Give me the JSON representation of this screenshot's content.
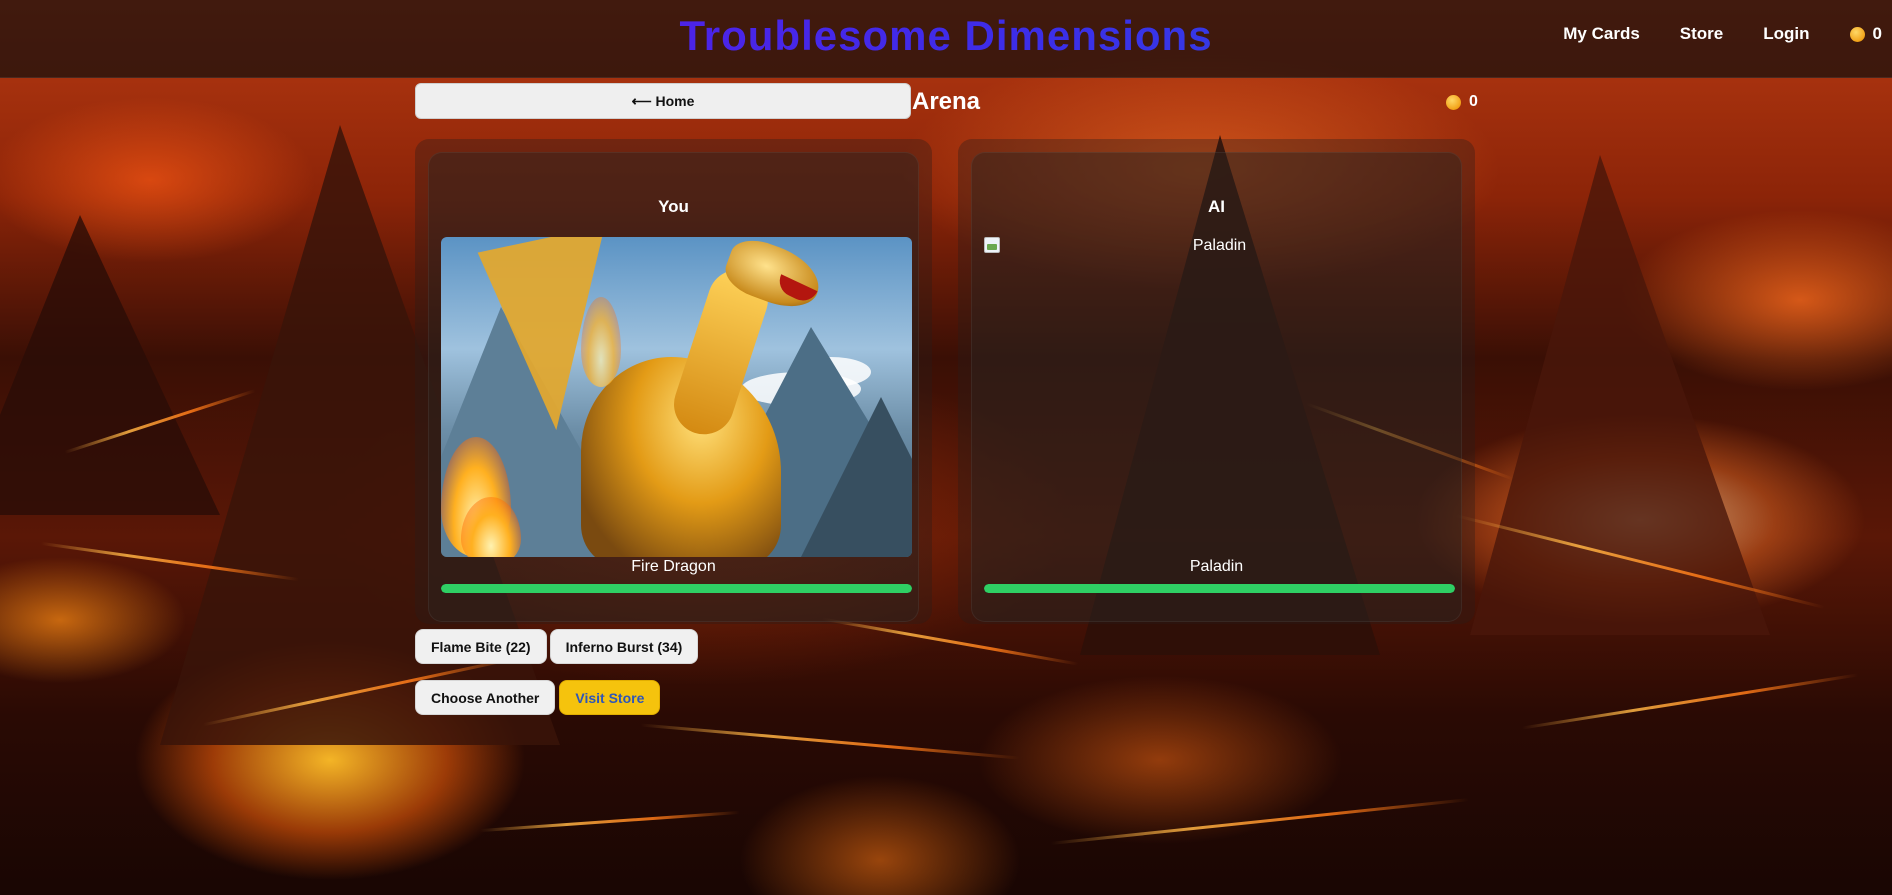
{
  "header": {
    "title": "Troublesome Dimensions",
    "nav": [
      {
        "label": "My Cards"
      },
      {
        "label": "Store"
      },
      {
        "label": "Login"
      }
    ],
    "coins": "0"
  },
  "arena": {
    "home_button": "⟵ Home",
    "title": "Arena",
    "coins": "0"
  },
  "player": {
    "side_label": "You",
    "card_name": "Fire Dragon",
    "hp_fraction": 1.0
  },
  "opponent": {
    "side_label": "AI",
    "image_alt": "Paladin",
    "card_name": "Paladin",
    "hp_fraction": 1.0
  },
  "moves": [
    {
      "label": "Flame Bite (22)"
    },
    {
      "label": "Inferno Burst (34)"
    }
  ],
  "controls": {
    "choose_another": "Choose Another",
    "visit_store": "Visit Store"
  },
  "colors": {
    "hp": "#2fcf64",
    "store_button": "#f5c30d",
    "title_gradient_start": "#6a10e8",
    "title_gradient_end": "#1f5fe0"
  },
  "icons": [
    "coin-icon",
    "broken-image-icon"
  ]
}
